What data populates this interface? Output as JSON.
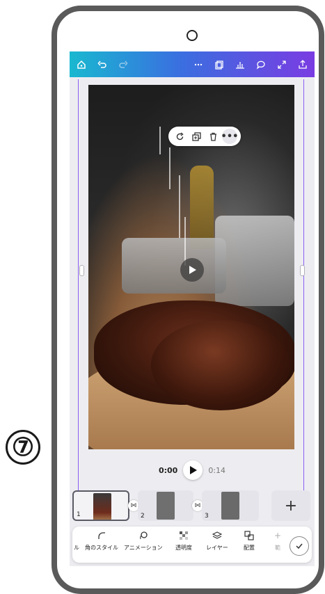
{
  "step_marker": "⑦",
  "toolbar": {
    "left_icons": [
      "home-icon",
      "undo-icon",
      "redo-icon"
    ],
    "right_icons": [
      "more-icon",
      "duplicate-page-icon",
      "chart-icon",
      "comment-icon",
      "fullscreen-icon",
      "share-icon"
    ]
  },
  "float_toolbar": {
    "icons": [
      "replace-icon",
      "copy-icon",
      "delete-icon",
      "more-icon"
    ],
    "more_label": "•••"
  },
  "playback": {
    "current_time": "0:00",
    "total_time": "0:14"
  },
  "timeline": {
    "clips": [
      {
        "number": "1",
        "selected": true
      },
      {
        "number": "2",
        "selected": false
      },
      {
        "number": "3",
        "selected": false
      }
    ],
    "add_label": "+"
  },
  "tools": [
    {
      "label": "ル",
      "icon": "cropped-tool-icon"
    },
    {
      "label": "角のスタイル",
      "icon": "corner-style-icon"
    },
    {
      "label": "アニメーション",
      "icon": "animation-icon"
    },
    {
      "label": "透明度",
      "icon": "transparency-icon"
    },
    {
      "label": "レイヤー",
      "icon": "layer-icon"
    },
    {
      "label": "配置",
      "icon": "position-icon"
    },
    {
      "label": "範",
      "icon": "partial-tool-icon"
    }
  ],
  "colors": {
    "toolbar_start": "#19b8d0",
    "toolbar_end": "#7a3ce2",
    "pointer": "#f0448a",
    "page_guide": "#8b5cf6"
  }
}
